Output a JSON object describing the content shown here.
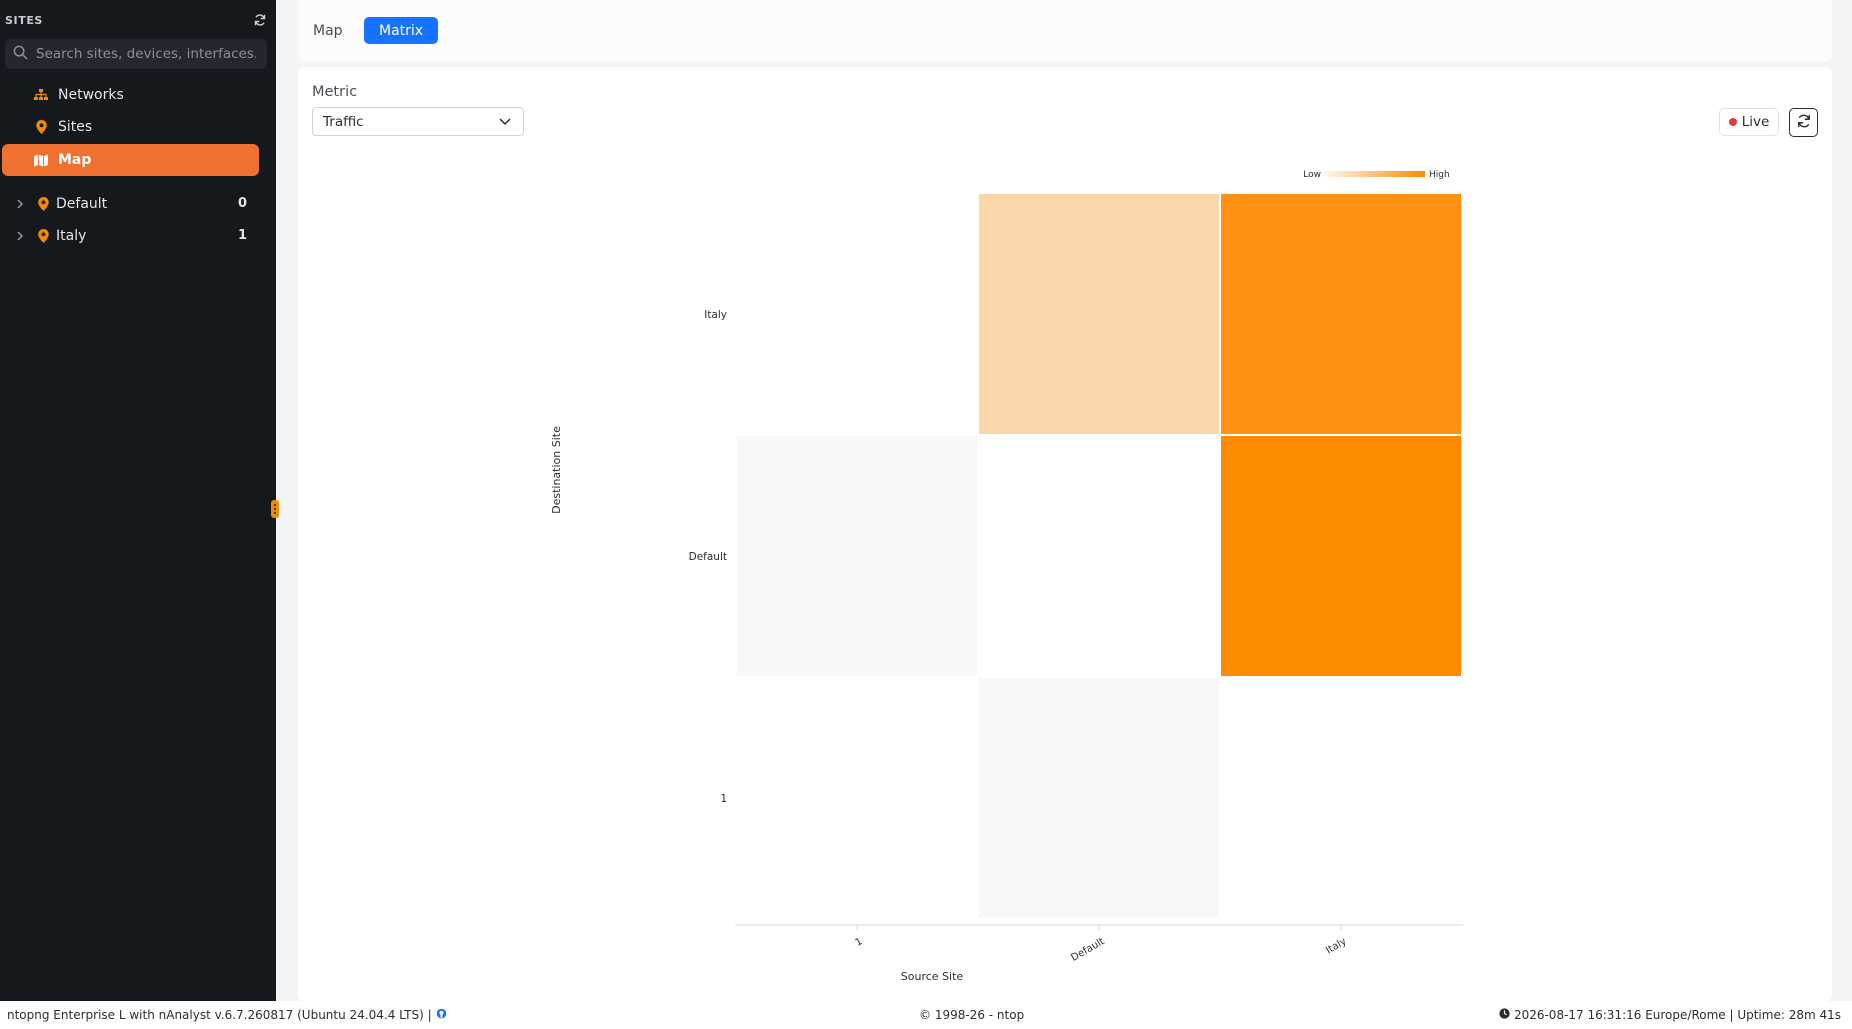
{
  "sidebar": {
    "title": "SITES",
    "search": {
      "placeholder": "Search sites, devices, interfaces..."
    },
    "nav": [
      {
        "label": "Networks",
        "icon": "sitemap-icon"
      },
      {
        "label": "Sites",
        "icon": "map-marker-icon"
      },
      {
        "label": "Map",
        "icon": "map-icon",
        "active": true
      }
    ],
    "tree": [
      {
        "label": "Default",
        "count": "0"
      },
      {
        "label": "Italy",
        "count": "1"
      }
    ]
  },
  "tabs": [
    {
      "label": "Map",
      "active": false
    },
    {
      "label": "Matrix",
      "active": true
    }
  ],
  "controls": {
    "metric_label": "Metric",
    "metric_value": "Traffic",
    "live_label": "Live"
  },
  "colors": {
    "accent": "#f07030",
    "tab_active": "#1673ff",
    "heat_high": "#ff8c00",
    "live_dot": "#e33b3b"
  },
  "chart_data": {
    "type": "heatmap",
    "xlabel": "Source Site",
    "ylabel": "Destination Site",
    "x_categories": [
      "1",
      "Default",
      "Italy"
    ],
    "y_categories": [
      "Italy",
      "Default",
      "1"
    ],
    "legend": {
      "low_label": "Low",
      "high_label": "High",
      "placement": "top-right"
    },
    "cells": [
      {
        "x": "1",
        "y": "Italy",
        "value": null
      },
      {
        "x": "Default",
        "y": "Italy",
        "value": 0.18
      },
      {
        "x": "Italy",
        "y": "Italy",
        "value": 0.92
      },
      {
        "x": "1",
        "y": "Default",
        "value": 0
      },
      {
        "x": "Default",
        "y": "Default",
        "value": null
      },
      {
        "x": "Italy",
        "y": "Default",
        "value": 1.0
      },
      {
        "x": "1",
        "y": "1",
        "value": null
      },
      {
        "x": "Default",
        "y": "1",
        "value": 0
      },
      {
        "x": "Italy",
        "y": "1",
        "value": null
      }
    ]
  },
  "footer": {
    "left": "ntopng Enterprise L with nAnalyst v.6.7.260817 (Ubuntu 24.04.4 LTS) |",
    "center": "© 1998-26 - ntop",
    "right": "2026-08-17 16:31:16  Europe/Rome | Uptime: 28m 41s"
  }
}
